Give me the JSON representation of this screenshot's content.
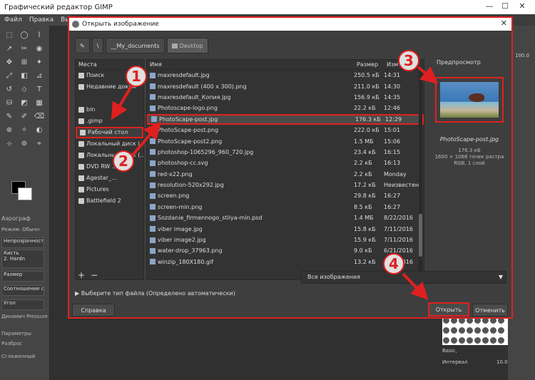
{
  "window": {
    "title": "Графический редактор GIMP",
    "min_label": "—",
    "max_label": "☐",
    "close_label": "✕"
  },
  "menu": [
    "Файл",
    "Правка",
    "Выде"
  ],
  "toolbox": {
    "tool_icons": [
      "⬚",
      "◯",
      "⌇",
      "↗",
      "✂",
      "◉",
      "✥",
      "⊞",
      "✦",
      "⤢",
      "◧",
      "⊿",
      "↺",
      "⬦",
      "T",
      "⛁",
      "◩",
      "▦",
      "✎",
      "✐",
      "⌫",
      "⊕",
      "✧",
      "◐",
      "⌯",
      "⊚",
      "⌖"
    ],
    "panel_title": "Аэрограф",
    "mode_label": "Режим:",
    "mode_value": "Обычн",
    "opacity_label": "Непрозрачность",
    "brush_label": "Кисть",
    "brush_name": "2. Hardn",
    "size_label": "Размер",
    "ratio_label": "Соотношение с",
    "angle_label": "Угол",
    "dynamics_label": "Динамич",
    "dynamics_value": "Pressure",
    "params_label": "Параметры",
    "spread_label": "Разброс",
    "smooth_label": "Сглаженный"
  },
  "right_dock": {
    "zoom_value": "100.0",
    "basic_label": "Basic,",
    "interval_label": "Интервал",
    "interval_value": "10.0"
  },
  "dialog": {
    "title": "Открыть изображение",
    "close_label": "✕",
    "path": [
      "\\",
      "__My_documents",
      "Desktop"
    ],
    "places_header": "Места",
    "places": [
      {
        "label": "Поиск",
        "icon": "search-icon"
      },
      {
        "label": "Недавние докум",
        "icon": "clock-icon"
      },
      {
        "label": "",
        "icon": ""
      },
      {
        "label": "bin",
        "icon": "folder-icon"
      },
      {
        "label": ".gimp",
        "icon": "folder-icon"
      },
      {
        "label": "Рабочий стол",
        "icon": "folder-icon",
        "selected": true
      },
      {
        "label": "Локальный диск (...",
        "icon": "drive-icon"
      },
      {
        "label": "Локальный диск (...",
        "icon": "drive-icon"
      },
      {
        "label": "DVD RW ...",
        "icon": "dvd-icon"
      },
      {
        "label": "Agestar_...",
        "icon": "drive-icon"
      },
      {
        "label": "Pictures",
        "icon": "folder-icon"
      },
      {
        "label": "Battlefield 2",
        "icon": "folder-icon"
      }
    ],
    "columns": {
      "name": "Имя",
      "size": "Размер",
      "modified": "Изм"
    },
    "files": [
      {
        "name": "maxresdefault.jpg",
        "size": "250.5 кБ",
        "date": "14:31"
      },
      {
        "name": "maxresdefault (400 x 300).png",
        "size": "211.0 кБ",
        "date": "14:30"
      },
      {
        "name": "maxresdefault_Копия.jpg",
        "size": "156.9 кБ",
        "date": "14:35"
      },
      {
        "name": "Photoscape-logo.png",
        "size": "22.2 кБ",
        "date": "12:46"
      },
      {
        "name": "PhotoScape-post.jpg",
        "size": "176.3 кБ",
        "date": "12:29",
        "highlighted": true
      },
      {
        "name": "PhotoScape-post.png",
        "size": "222.0 кБ",
        "date": "15:01"
      },
      {
        "name": "PhotoScape-post2.png",
        "size": "1.5 МБ",
        "date": "15:06"
      },
      {
        "name": "photoshop-1065296_960_720.jpg",
        "size": "23.4 кБ",
        "date": "16:15"
      },
      {
        "name": "photoshop-cc.svg",
        "size": "2.2 кБ",
        "date": "16:13"
      },
      {
        "name": "red-x22.png",
        "size": "2.2 кБ",
        "date": "Monday"
      },
      {
        "name": "resolution-520x292.jpg",
        "size": "17.2 кБ",
        "date": "Неизвестен"
      },
      {
        "name": "screen.png",
        "size": "29.8 кБ",
        "date": "16:27"
      },
      {
        "name": "screen-min.png",
        "size": "8.5 кБ",
        "date": "16:27"
      },
      {
        "name": "Sozdanie_firmennogo_stilya-min.psd",
        "size": "1.4 МБ",
        "date": "8/22/2016"
      },
      {
        "name": "viber image.jpg",
        "size": "15.8 кБ",
        "date": "7/11/2016"
      },
      {
        "name": "viber image2.jpg",
        "size": "15.9 кБ",
        "date": "7/11/2016"
      },
      {
        "name": "water-drop_37963.png",
        "size": "9.0 кБ",
        "date": "6/21/2016"
      },
      {
        "name": "winzip_180X180.gif",
        "size": "13.2 кБ",
        "date": "6/15/2016"
      }
    ],
    "preview": {
      "header": "Предпросмотр",
      "filename": "PhotoScape-post.jpg",
      "size": "176.3 кБ",
      "dimensions": "1600 × 1066 точек растра",
      "mode": "RGB, 1 слой"
    },
    "add_label": "+",
    "remove_label": "−",
    "filter_value": "Все изображения",
    "filetype_label": "Выберите тип файла (Определено автоматически)",
    "help_label": "Справка",
    "open_label": "Открыть",
    "cancel_label": "Отменить"
  },
  "annotations": [
    "1",
    "2",
    "3",
    "4"
  ],
  "colors": {
    "annotation_red": "#e02020",
    "dialog_bg": "#3e3e3e",
    "panel_bg": "#333333"
  }
}
